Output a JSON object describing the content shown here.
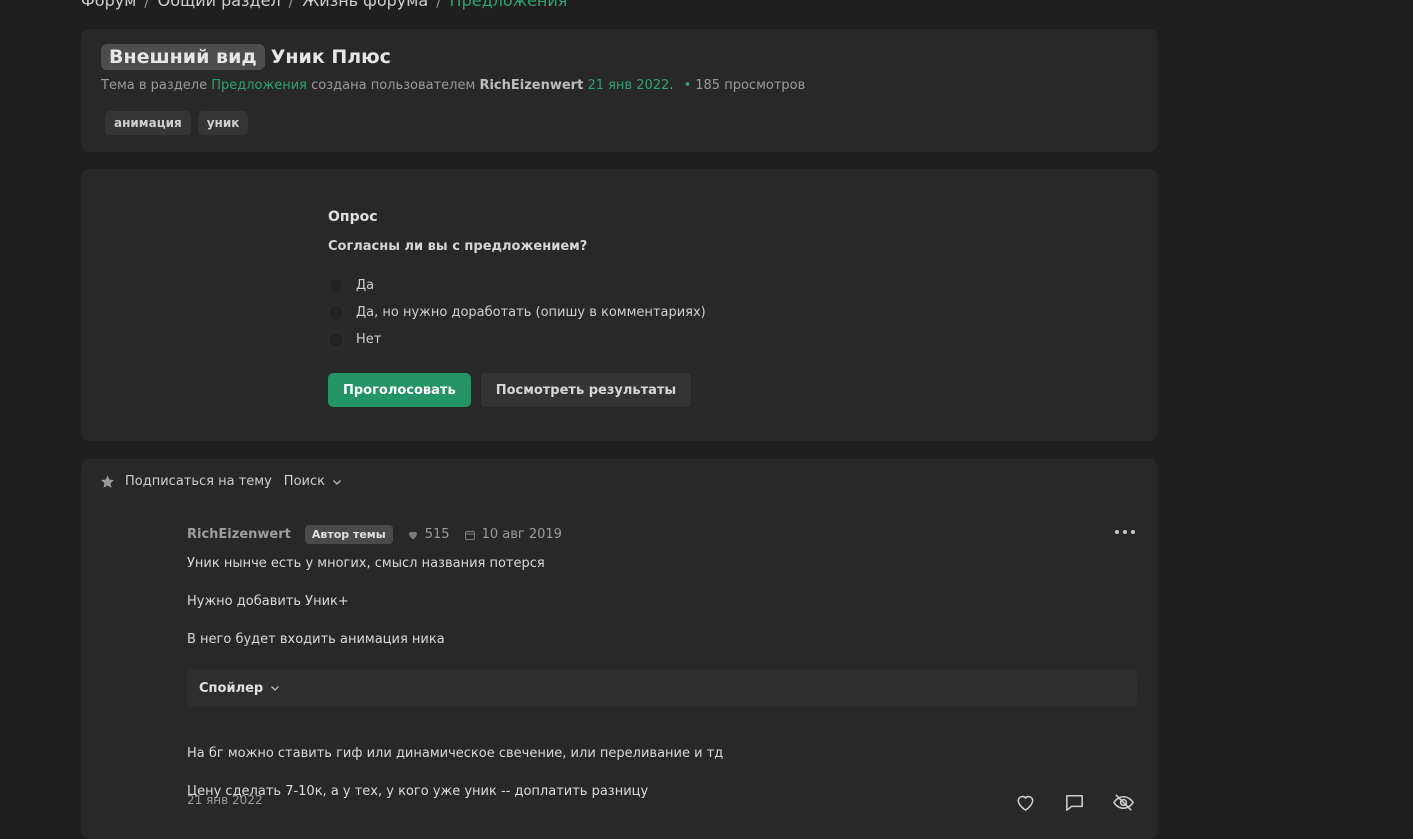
{
  "breadcrumb": {
    "items": [
      "Форум",
      "Общий раздел",
      "Жизнь форума",
      "Предложения"
    ],
    "separator": "/"
  },
  "thread": {
    "prefix": "Внешний вид",
    "title": "Уник Плюс",
    "meta": {
      "topic_in": "Тема в разделе",
      "section": "Предложения",
      "created_by": "создана пользователем",
      "author": "RichEizenwert",
      "date": "21 янв 2022",
      "views": "185 просмотров"
    },
    "tags": [
      "анимация",
      "уник"
    ]
  },
  "poll": {
    "title": "Опрос",
    "question": "Согласны ли вы с предложением?",
    "options": [
      "Да",
      "Да, но нужно доработать (опишу в комментариях)",
      "Нет"
    ],
    "vote_label": "Проголосовать",
    "results_label": "Посмотреть результаты"
  },
  "toolbar": {
    "subscribe_label": "Подписаться на тему",
    "search_label": "Поиск"
  },
  "post": {
    "author": "RichEizenwert",
    "badge": "Автор темы",
    "likes": "515",
    "reg_date": "10 авг 2019",
    "paragraphs": [
      "Уник нынче есть у многих, смысл названия потерся",
      "Нужно добавить Уник+",
      "В него будет входить анимация ника"
    ],
    "spoiler_label": "Спойлер",
    "paragraphs_after": [
      "На бг можно ставить гиф или динамическое свечение, или переливание и тд",
      "Цену сделать 7-10к, а у тех, у кого уже уник -- доплатить разницу"
    ],
    "date": "21 янв 2022"
  },
  "colors": {
    "accent": "#239463",
    "link": "#2da36e",
    "background": "#1f1f1f",
    "card": "#282828"
  }
}
